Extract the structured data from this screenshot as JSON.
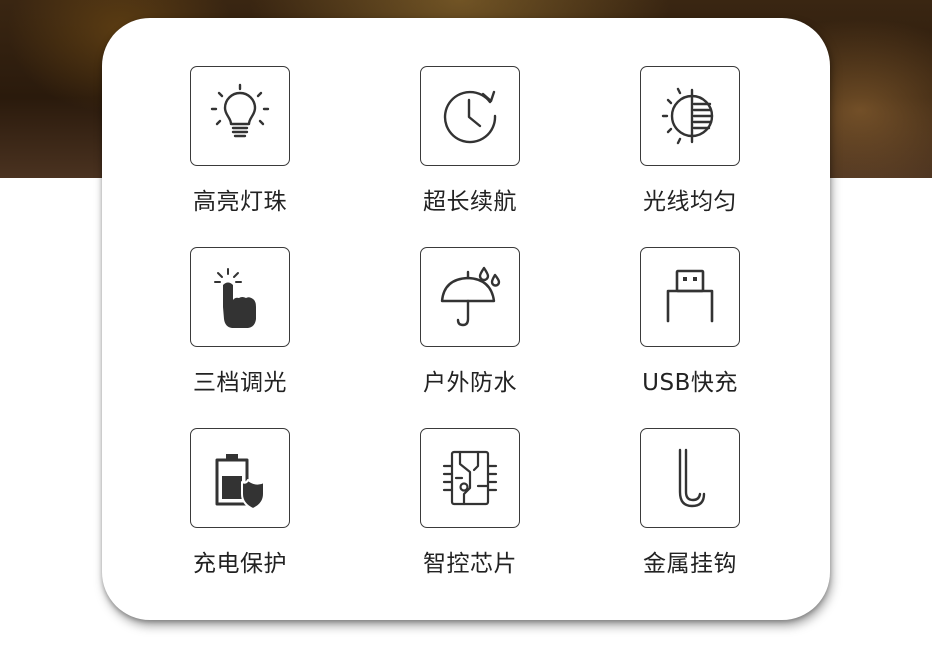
{
  "features": [
    {
      "icon": "lightbulb-icon",
      "label": "高亮灯珠"
    },
    {
      "icon": "clock-icon",
      "label": "超长续航"
    },
    {
      "icon": "even-light-icon",
      "label": "光线均匀"
    },
    {
      "icon": "finger-tap-icon",
      "label": "三档调光"
    },
    {
      "icon": "umbrella-icon",
      "label": "户外防水"
    },
    {
      "icon": "usb-icon",
      "label": "USB快充"
    },
    {
      "icon": "battery-shield-icon",
      "label": "充电保护"
    },
    {
      "icon": "chip-icon",
      "label": "智控芯片"
    },
    {
      "icon": "hook-icon",
      "label": "金属挂钩"
    }
  ],
  "colors": {
    "icon_stroke": "#3a3a3a",
    "label_text": "#222222",
    "card_bg": "#ffffff"
  }
}
